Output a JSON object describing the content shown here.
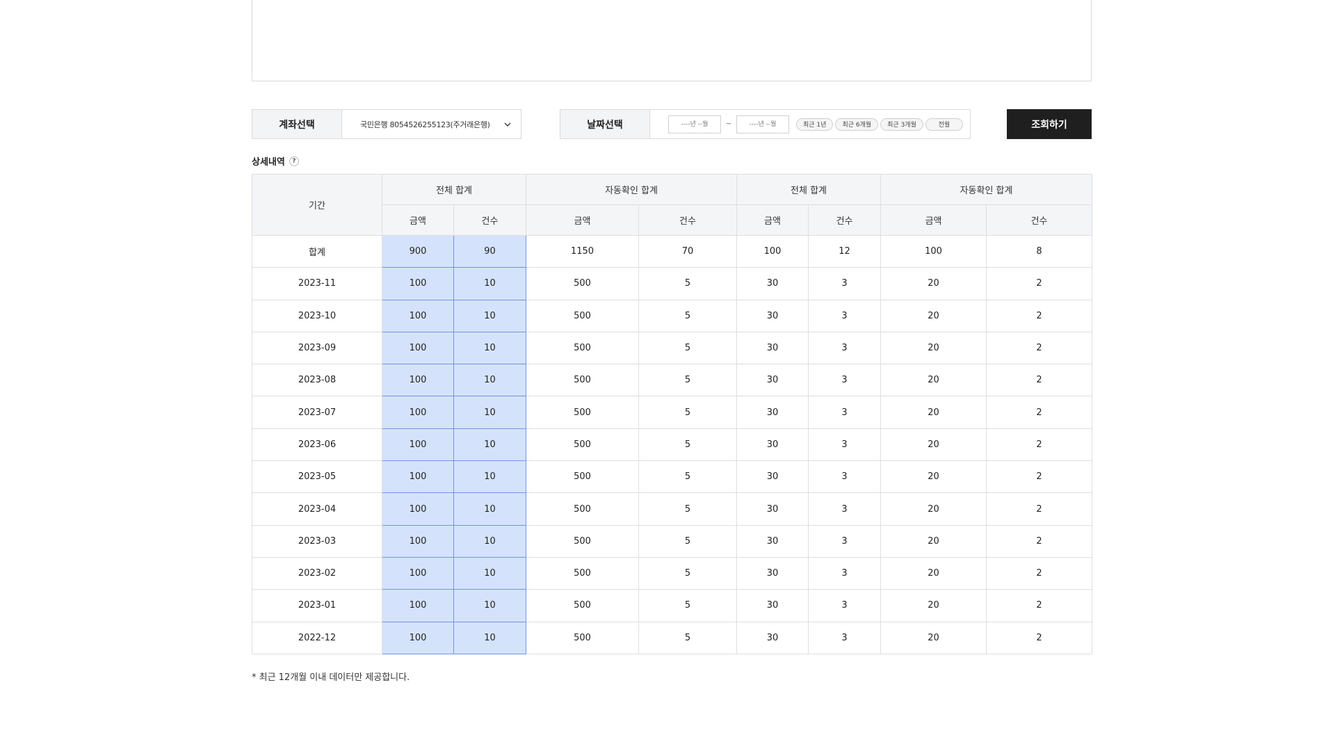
{
  "filters": {
    "account_label": "계좌선택",
    "account_value": "국민은행 8054526255123(주거래은행)",
    "date_label": "날짜선택",
    "date_from_placeholder": "----년 --월",
    "date_separator": "~",
    "date_to_placeholder": "----년 --월",
    "quick_ranges": [
      "최근 1년",
      "최근 6개월",
      "최근 3개월",
      "전월"
    ],
    "search_button": "조회하기"
  },
  "section": {
    "title": "상세내역",
    "help_icon_text": "?"
  },
  "table": {
    "period_header": "기간",
    "group_headers": [
      "전체 합계",
      "자동확인 합계",
      "전체 합계",
      "자동확인 합계"
    ],
    "sub_headers": [
      "금액",
      "건수",
      "금액",
      "건수",
      "금액",
      "건수",
      "금액",
      "건수"
    ],
    "rows": [
      [
        "합계",
        "900",
        "90",
        "1150",
        "70",
        "100",
        "12",
        "100",
        "8"
      ],
      [
        "2023-11",
        "100",
        "10",
        "500",
        "5",
        "30",
        "3",
        "20",
        "2"
      ],
      [
        "2023-10",
        "100",
        "10",
        "500",
        "5",
        "30",
        "3",
        "20",
        "2"
      ],
      [
        "2023-09",
        "100",
        "10",
        "500",
        "5",
        "30",
        "3",
        "20",
        "2"
      ],
      [
        "2023-08",
        "100",
        "10",
        "500",
        "5",
        "30",
        "3",
        "20",
        "2"
      ],
      [
        "2023-07",
        "100",
        "10",
        "500",
        "5",
        "30",
        "3",
        "20",
        "2"
      ],
      [
        "2023-06",
        "100",
        "10",
        "500",
        "5",
        "30",
        "3",
        "20",
        "2"
      ],
      [
        "2023-05",
        "100",
        "10",
        "500",
        "5",
        "30",
        "3",
        "20",
        "2"
      ],
      [
        "2023-04",
        "100",
        "10",
        "500",
        "5",
        "30",
        "3",
        "20",
        "2"
      ],
      [
        "2023-03",
        "100",
        "10",
        "500",
        "5",
        "30",
        "3",
        "20",
        "2"
      ],
      [
        "2023-02",
        "100",
        "10",
        "500",
        "5",
        "30",
        "3",
        "20",
        "2"
      ],
      [
        "2023-01",
        "100",
        "10",
        "500",
        "5",
        "30",
        "3",
        "20",
        "2"
      ],
      [
        "2022-12",
        "100",
        "10",
        "500",
        "5",
        "30",
        "3",
        "20",
        "2"
      ]
    ],
    "highlight_color": "#d5e2fb"
  },
  "footnote": "* 최근 12개월 이내 데이터만 제공합니다.",
  "colors": {
    "button_bg": "#1f1f1f",
    "header_bg": "#f4f5f7",
    "highlight_border": "#6f95e0"
  }
}
